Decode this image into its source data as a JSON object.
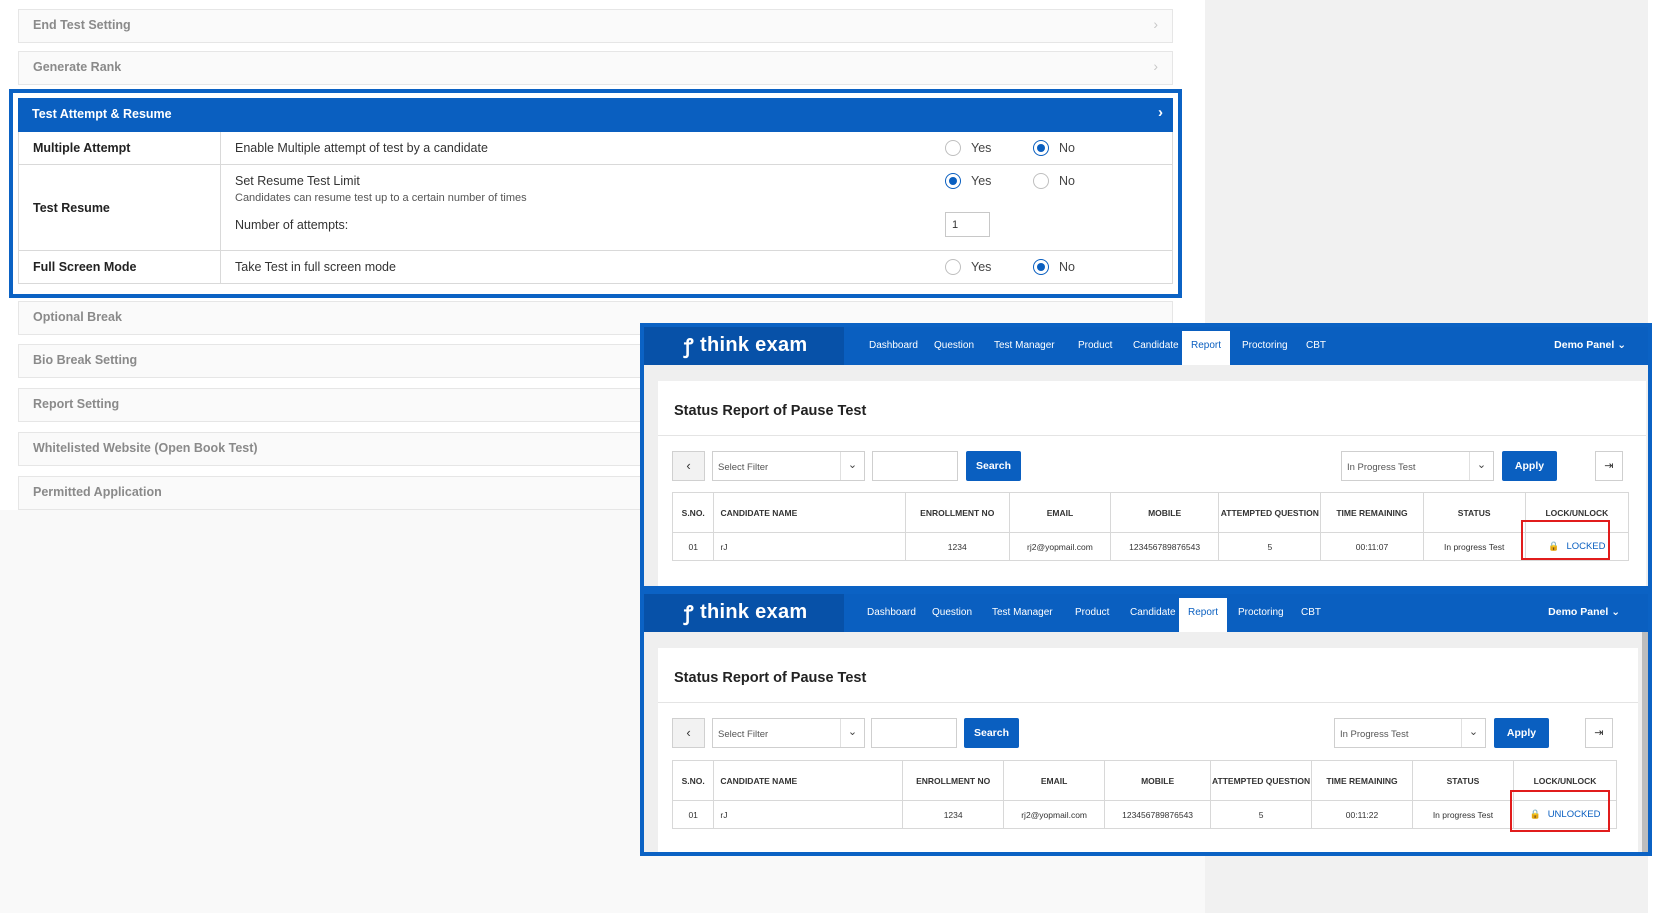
{
  "accordion_top": [
    "End Test Setting",
    "Generate Rank"
  ],
  "accordion_bottom": [
    "Optional Break",
    "Bio Break Setting",
    "Report Setting",
    "Whitelisted Website (Open Book Test)",
    "Permitted Application"
  ],
  "attempt_section": {
    "title": "Test Attempt & Resume",
    "rows": {
      "multiple": {
        "label": "Multiple Attempt",
        "desc": "Enable Multiple attempt of test by a candidate",
        "selected": "No"
      },
      "resume": {
        "label": "Test Resume",
        "desc": "Set Resume Test Limit",
        "sub": "Candidates can resume test up to a certain number of times",
        "attempts_label": "Number of attempts:",
        "attempts_value": "1",
        "selected": "Yes"
      },
      "fullscreen": {
        "label": "Full Screen Mode",
        "desc": "Take Test in full screen mode",
        "selected": "No"
      }
    },
    "yes": "Yes",
    "no": "No"
  },
  "app": {
    "logo": "think exam",
    "nav": [
      "Dashboard",
      "Question",
      "Test Manager",
      "Product",
      "Candidate",
      "Report",
      "Proctoring",
      "CBT"
    ],
    "active_nav": "Report",
    "user_menu": "Demo Panel"
  },
  "report": {
    "title": "Status Report of Pause Test",
    "filter_placeholder": "Select Filter",
    "search_label": "Search",
    "status_filter": "In Progress Test",
    "apply_label": "Apply",
    "columns": [
      "S.NO.",
      "CANDIDATE NAME",
      "ENROLLMENT NO",
      "EMAIL",
      "MOBILE",
      "ATTEMPTED QUESTION",
      "TIME REMAINING",
      "STATUS",
      "LOCK/UNLOCK"
    ],
    "panel1_row": {
      "sno": "01",
      "name": "rJ",
      "enroll": "1234",
      "email": "rj2@yopmail.com",
      "mobile": "123456789876543",
      "attempted": "5",
      "time": "00:11:07",
      "status": "In progress Test",
      "lock": "LOCKED"
    },
    "panel2_row": {
      "sno": "01",
      "name": "rJ",
      "enroll": "1234",
      "email": "rj2@yopmail.com",
      "mobile": "123456789876543",
      "attempted": "5",
      "time": "00:11:22",
      "status": "In progress Test",
      "lock": "UNLOCKED"
    }
  },
  "colors": {
    "primary": "#0a5fc0",
    "highlight": "#e11c1c"
  }
}
